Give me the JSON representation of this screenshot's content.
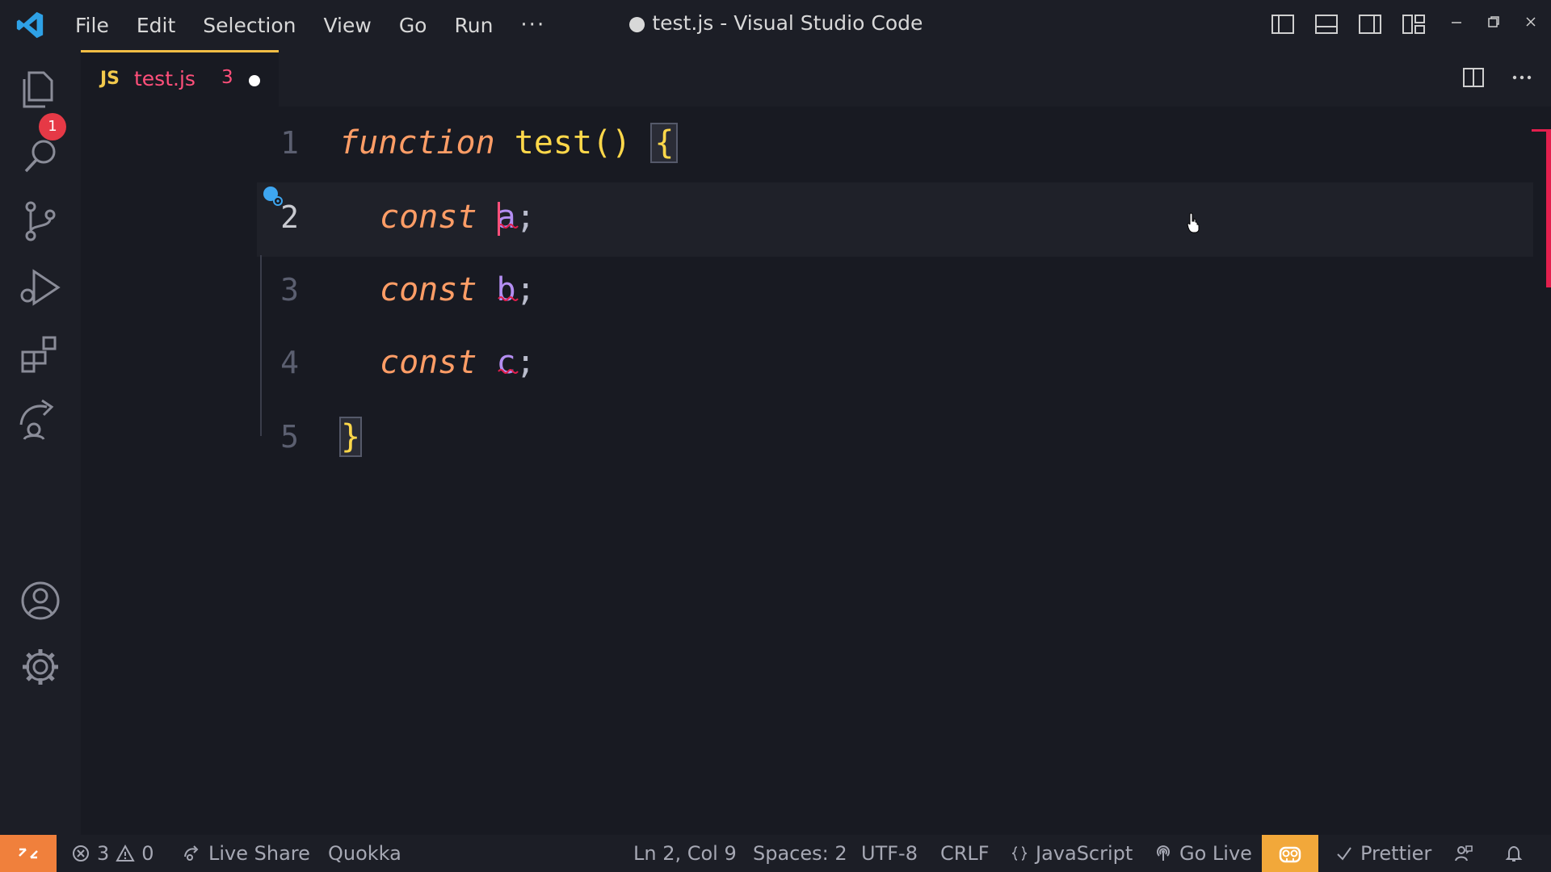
{
  "window": {
    "title": "● test.js - Visual Studio Code"
  },
  "menu": [
    "File",
    "Edit",
    "Selection",
    "View",
    "Go",
    "Run",
    "···"
  ],
  "activity": {
    "explorer_badge": "1"
  },
  "tab": {
    "icon_text": "JS",
    "filename": "test.js",
    "problem_count": "3"
  },
  "editor": {
    "lines": [
      {
        "number": "1",
        "tokens": {
          "kw": "function",
          "fn": "test",
          "paren": "()",
          "brace": "{"
        }
      },
      {
        "number": "2",
        "tokens": {
          "kw": "const",
          "var": "a",
          "semi": ";"
        }
      },
      {
        "number": "3",
        "tokens": {
          "kw": "const",
          "var": "b",
          "semi": ";"
        }
      },
      {
        "number": "4",
        "tokens": {
          "kw": "const",
          "var": "c",
          "semi": ";"
        }
      },
      {
        "number": "5",
        "tokens": {
          "brace": "}"
        }
      }
    ],
    "active_line": 2
  },
  "status": {
    "errors": "3",
    "warnings": "0",
    "live_share": "Live Share",
    "quokka": "Quokka",
    "position": "Ln 2, Col 9",
    "spaces": "Spaces: 2",
    "encoding": "UTF-8",
    "eol": "CRLF",
    "language": "JavaScript",
    "go_live": "Go Live",
    "prettier": "Prettier"
  },
  "colors": {
    "accent_tab": "#f2bd45",
    "error": "#ff4f7a",
    "remote_bg": "#f0803c",
    "highlight_bg": "#f2a83a"
  },
  "icons": [
    "vscode-logo-icon",
    "explorer-icon",
    "search-icon",
    "source-control-icon",
    "run-debug-icon",
    "extensions-icon",
    "live-share-icon",
    "account-icon",
    "settings-gear-icon",
    "split-editor-icon",
    "more-actions-icon",
    "remote-icon",
    "error-icon",
    "warning-icon",
    "broadcast-icon",
    "copilot-icon",
    "check-icon",
    "feedback-icon",
    "bell-icon"
  ]
}
